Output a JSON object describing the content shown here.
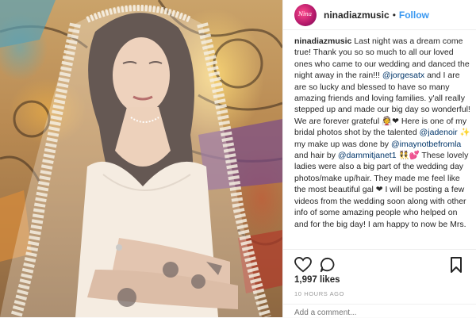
{
  "post": {
    "username": "ninadiazmusic",
    "follow_label": "Follow",
    "avatar_text": "Nina"
  },
  "caption": {
    "username": "ninadiazmusic",
    "t1": " Last night was a dream come true! Thank you so so much to all our loved ones who came to our wedding and danced the night away in the rain!!! ",
    "m1": "@jorgesatx",
    "t2": " and I are are so lucky and blessed to have so many amazing friends and loving families. y'all really stepped up and made our big day so wonderful! We are forever grateful 👰❤ Here is one of my bridal photos shot by the talented ",
    "m2": "@jadenoir",
    "t3": " ✨ my make up was done by ",
    "m3": "@imaynotbefromla",
    "t4": " and hair by ",
    "m4": "@dammitjanet1",
    "t5": " 👯💕 These lovely ladies were also a big part of the wedding day photos/make up/hair. They made me feel like the most beautiful gal ❤ I will be posting a few videos from the wedding soon along with other info of some amazing people who helped on and for the big day! I am happy to now be Mrs."
  },
  "likes": "1,997 likes",
  "time": "10 HOURS AGO",
  "comment": {
    "placeholder": "Add a comment..."
  },
  "icons": {
    "like": "heart-icon",
    "comment": "comment-icon",
    "save": "bookmark-icon"
  },
  "colors": {
    "link": "#3897f0",
    "mention": "#003569",
    "muted": "#999999"
  }
}
